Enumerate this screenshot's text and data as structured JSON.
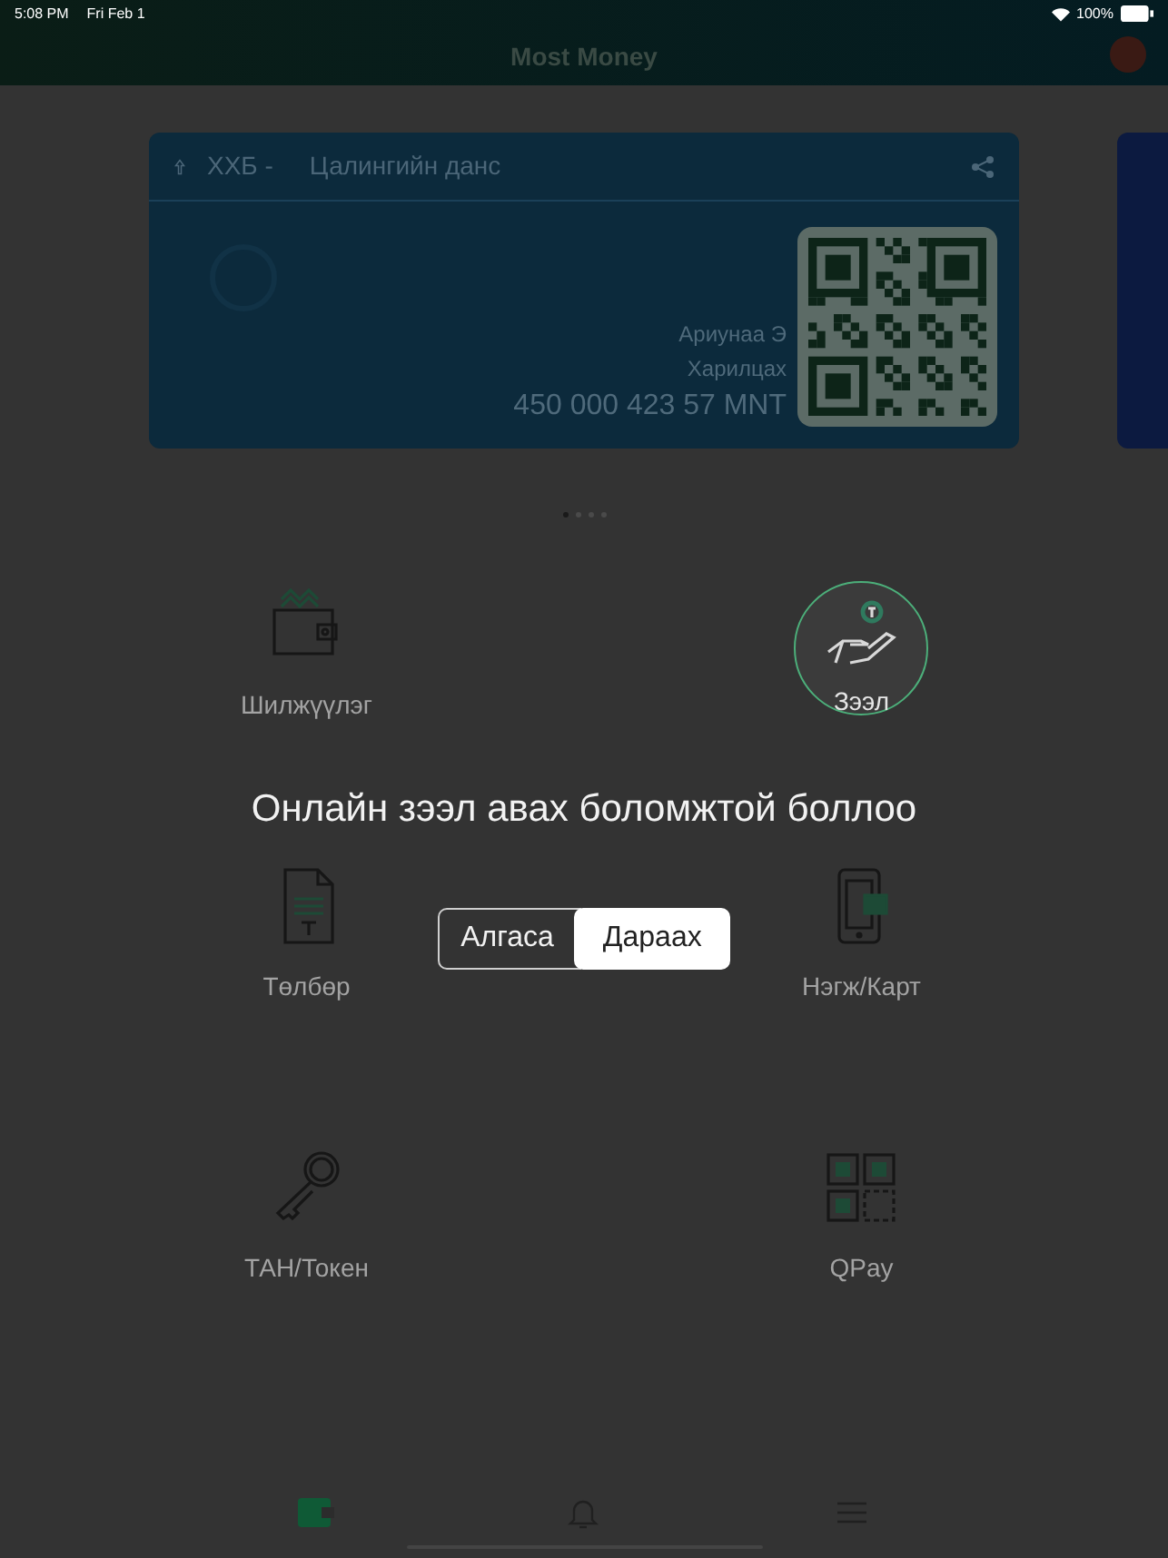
{
  "status_bar": {
    "time": "5:08 PM",
    "date": "Fri Feb 1",
    "battery": "100%"
  },
  "header": {
    "title": "Most Money"
  },
  "account_card": {
    "bank": "ХХБ -",
    "account_type": "Цалингийн данс",
    "owner": "Ариунаа Э",
    "category": "Харилцах",
    "balance": "450 000 423 57 MNT"
  },
  "carousel_pages": [
    {
      "selected": true
    },
    {
      "selected": false
    },
    {
      "selected": false
    },
    {
      "selected": false
    }
  ],
  "menu_items": [
    {
      "kind": "wallet",
      "label": "Шилжүүлэг",
      "highlighted": false
    },
    {
      "kind": "loan",
      "label": "Зээл",
      "highlighted": true
    },
    {
      "kind": "invoice",
      "label": "Төлбөр",
      "highlighted": false
    },
    {
      "kind": "phone",
      "label": "Нэгж/Карт",
      "highlighted": false
    },
    {
      "kind": "key",
      "label": "ТАН/Токен",
      "highlighted": false
    },
    {
      "kind": "qr",
      "label": "QPay",
      "highlighted": false
    }
  ],
  "coach_mark": {
    "message": "Онлайн зээл авах боломжтой боллоо",
    "skip_button": "Алгаса",
    "next_button": "Дараах"
  },
  "tab_bar": [
    {
      "kind": "wallet",
      "selected": true
    },
    {
      "kind": "bell",
      "selected": false
    },
    {
      "kind": "menu",
      "selected": false
    }
  ]
}
